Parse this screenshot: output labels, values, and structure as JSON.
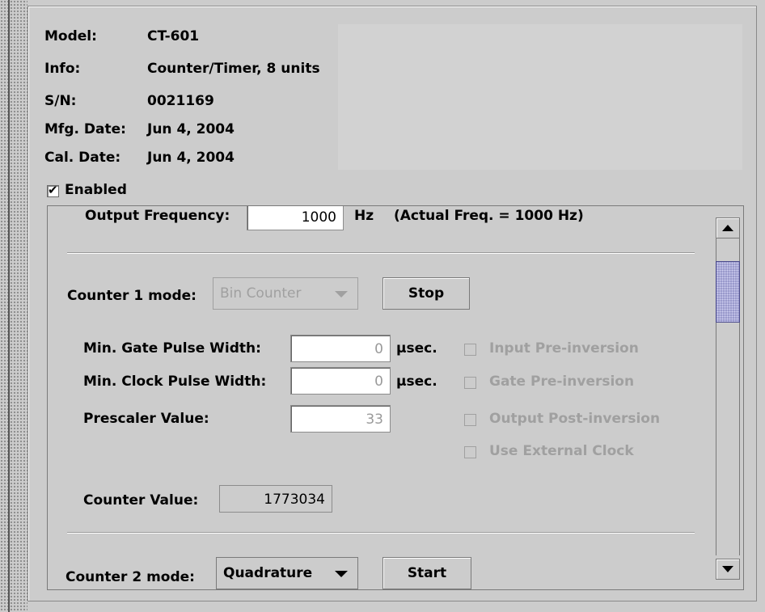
{
  "device_info": {
    "model_label": "Model:",
    "model_value": "CT-601",
    "info_label": "Info:",
    "info_value": "Counter/Timer, 8 units",
    "sn_label": "S/N:",
    "sn_value": "0021169",
    "mfg_label": "Mfg. Date:",
    "mfg_value": "Jun 4, 2004",
    "cal_label": "Cal. Date:",
    "cal_value": "Jun 4, 2004"
  },
  "enabled": {
    "label": "Enabled",
    "checked": true,
    "tick": "✔"
  },
  "output": {
    "label": "Output Frequency:",
    "value": "1000",
    "unit": "Hz",
    "actual": "(Actual Freq. = 1000 Hz)"
  },
  "counter1": {
    "mode_label": "Counter 1 mode:",
    "mode_value": "Bin Counter",
    "button_label": "Stop",
    "gate_label": "Min. Gate Pulse Width:",
    "gate_value": "0",
    "gate_unit": "µsec.",
    "clock_label": "Min. Clock Pulse Width:",
    "clock_value": "0",
    "clock_unit": "µsec.",
    "prescaler_label": "Prescaler Value:",
    "prescaler_value": "33",
    "options": [
      "Input Pre-inversion",
      "Gate Pre-inversion",
      "Output Post-inversion",
      "Use External Clock"
    ],
    "counter_value_label": "Counter Value:",
    "counter_value": "1773034"
  },
  "counter2": {
    "mode_label": "Counter 2 mode:",
    "mode_value": "Quadrature",
    "button_label": "Start"
  },
  "colors": {
    "background": "#cccccc",
    "disabled_text": "#a0a0a0",
    "scroll_thumb": "#9a9acc"
  }
}
